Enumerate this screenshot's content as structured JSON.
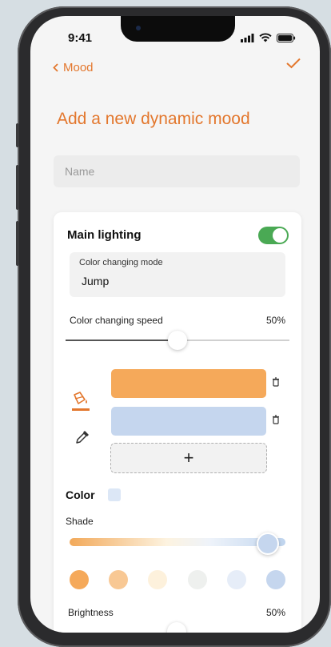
{
  "status_bar": {
    "time": "9:41"
  },
  "nav": {
    "back_label": "Mood"
  },
  "page": {
    "title": "Add a new dynamic mood"
  },
  "form": {
    "name_placeholder": "Name",
    "name_value": ""
  },
  "main_lighting": {
    "title": "Main lighting",
    "enabled": true,
    "mode": {
      "label": "Color changing mode",
      "value": "Jump"
    },
    "speed": {
      "label": "Color changing speed",
      "value_text": "50%",
      "value": 0.5
    },
    "swatches": [
      {
        "color": "#f5a95a"
      },
      {
        "color": "#c5d6ee"
      }
    ],
    "add_label": "+",
    "color": {
      "label": "Color",
      "current": "#dce7f6"
    },
    "shade": {
      "label": "Shade",
      "value": 0.92
    },
    "presets": [
      "#f5a95a",
      "#f8c894",
      "#fdf1dc",
      "#eef0ee",
      "#e6edf8",
      "#c5d6ee"
    ],
    "brightness": {
      "label": "Brightness",
      "value_text": "50%",
      "value": 0.5
    }
  },
  "colors": {
    "accent": "#e3772d",
    "toggle_on": "#4aa954"
  }
}
